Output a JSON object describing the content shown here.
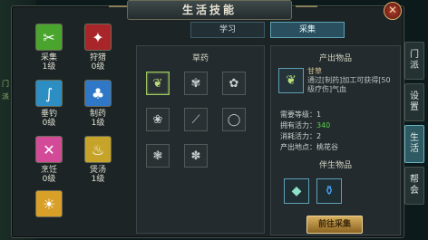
{
  "window": {
    "title": "生活技能",
    "close_icon": "close-icon"
  },
  "background_left_text": [
    "门",
    "派"
  ],
  "tabs": [
    {
      "label": "学习",
      "active": false
    },
    {
      "label": "采集",
      "active": true
    }
  ],
  "skills": [
    {
      "name": "采集",
      "level": "1级",
      "icon": "gather-icon",
      "color": "#4aa52e"
    },
    {
      "name": "狩猎",
      "level": "0级",
      "icon": "hunt-icon",
      "color": "#a8262a"
    },
    {
      "name": "垂钓",
      "level": "0级",
      "icon": "fishing-icon",
      "color": "#2d8ec4"
    },
    {
      "name": "制药",
      "level": "1级",
      "icon": "medicine-icon",
      "color": "#2f78c8"
    },
    {
      "name": "烹饪",
      "level": "0级",
      "icon": "cooking-icon",
      "color": "#d24a98"
    },
    {
      "name": "煲汤",
      "level": "1级",
      "icon": "soup-icon",
      "color": "#c6a42a"
    },
    {
      "name": "",
      "level": "",
      "icon": "fire-skill-icon",
      "color": "#d8a028"
    }
  ],
  "herbs_section": {
    "title": "草药",
    "items": [
      {
        "icon": "licorice-herb-icon",
        "selected": true
      },
      {
        "icon": "herb-2-icon",
        "selected": false
      },
      {
        "icon": "herb-3-icon",
        "selected": false
      },
      {
        "icon": "herb-4-icon",
        "selected": false
      },
      {
        "icon": "herb-5-icon",
        "selected": false
      },
      {
        "icon": "ring-herb-icon",
        "selected": false
      },
      {
        "icon": "herb-7-icon",
        "selected": false
      },
      {
        "icon": "herb-8-icon",
        "selected": false
      }
    ]
  },
  "output_section": {
    "title": "产出物品",
    "item_name": "甘草",
    "item_desc": "通过[制药]加工可获得[50级疗伤]气血",
    "stats": [
      {
        "label": "需要等级：",
        "value": "1",
        "highlight": false
      },
      {
        "label": "拥有活力：",
        "value": "340",
        "highlight": true
      },
      {
        "label": "消耗活力：",
        "value": "2",
        "highlight": false
      },
      {
        "label": "产出地点：",
        "value": "桃花谷",
        "highlight": false
      }
    ],
    "byproduct_title": "伴生物品",
    "byproducts": [
      {
        "icon": "jade-byproduct-icon"
      },
      {
        "icon": "potion-byproduct-icon"
      }
    ]
  },
  "go_button": "前往采集",
  "right_tabs": [
    {
      "label": "门派",
      "active": false
    },
    {
      "label": "设置",
      "active": false
    },
    {
      "label": "生活",
      "active": true
    },
    {
      "label": "帮会",
      "active": false
    }
  ]
}
